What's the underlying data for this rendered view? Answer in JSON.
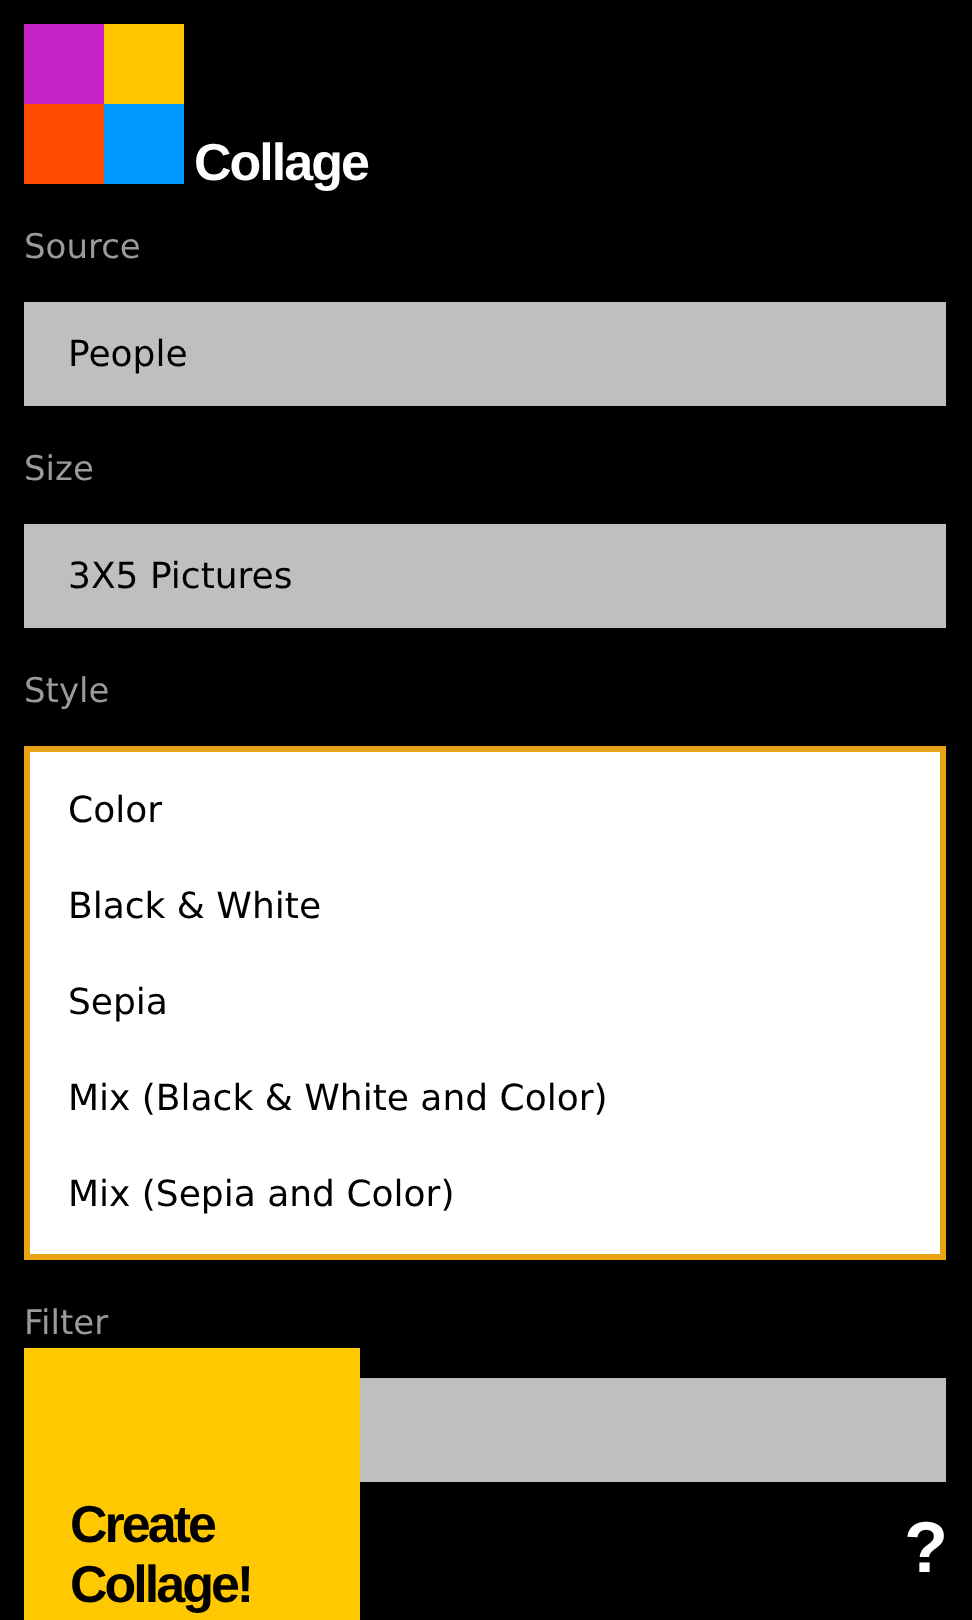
{
  "app": {
    "title": "Collage"
  },
  "fields": [
    {
      "label": "Source",
      "value": "People"
    },
    {
      "label": "Size",
      "value": "3X5 Pictures"
    }
  ],
  "style": {
    "label": "Style",
    "options": [
      "Color",
      "Black & White",
      "Sepia",
      "Mix (Black & White and Color)",
      "Mix (Sepia and Color)"
    ]
  },
  "filter": {
    "label": "Filter"
  },
  "create_button": "Create Collage!",
  "help_button": "?"
}
